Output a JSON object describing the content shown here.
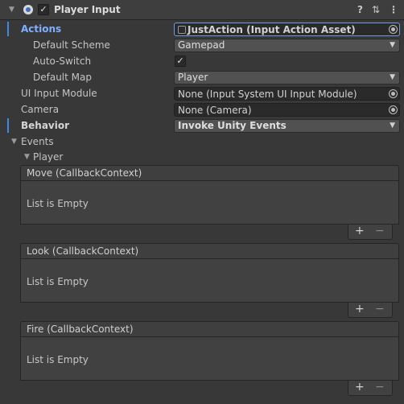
{
  "header": {
    "title": "Player Input",
    "enabled": true
  },
  "properties": {
    "actions": {
      "label": "Actions",
      "value": "JustAction (Input Action Asset)"
    },
    "default_scheme": {
      "label": "Default Scheme",
      "value": "Gamepad"
    },
    "auto_switch": {
      "label": "Auto-Switch",
      "checked": true
    },
    "default_map": {
      "label": "Default Map",
      "value": "Player"
    },
    "ui_input_module": {
      "label": "UI Input Module",
      "value": "None (Input System UI Input Module)"
    },
    "camera": {
      "label": "Camera",
      "value": "None (Camera)"
    },
    "behavior": {
      "label": "Behavior",
      "value": "Invoke Unity Events"
    }
  },
  "events": {
    "label": "Events",
    "group_label": "Player",
    "items": [
      {
        "name": "Move (CallbackContext)",
        "empty_text": "List is Empty"
      },
      {
        "name": "Look (CallbackContext)",
        "empty_text": "List is Empty"
      },
      {
        "name": "Fire (CallbackContext)",
        "empty_text": "List is Empty"
      }
    ]
  },
  "glyphs": {
    "check": "✓",
    "plus": "+",
    "minus": "−",
    "fold_open": "▼",
    "dropdown_arrow": "▼",
    "help": "?",
    "presets": "⇅",
    "more": "⋮"
  },
  "colors": {
    "accent_label": "#7fb0ff",
    "prefab_bar": "#3f8ae0",
    "field_highlight": "#6d9de0"
  }
}
